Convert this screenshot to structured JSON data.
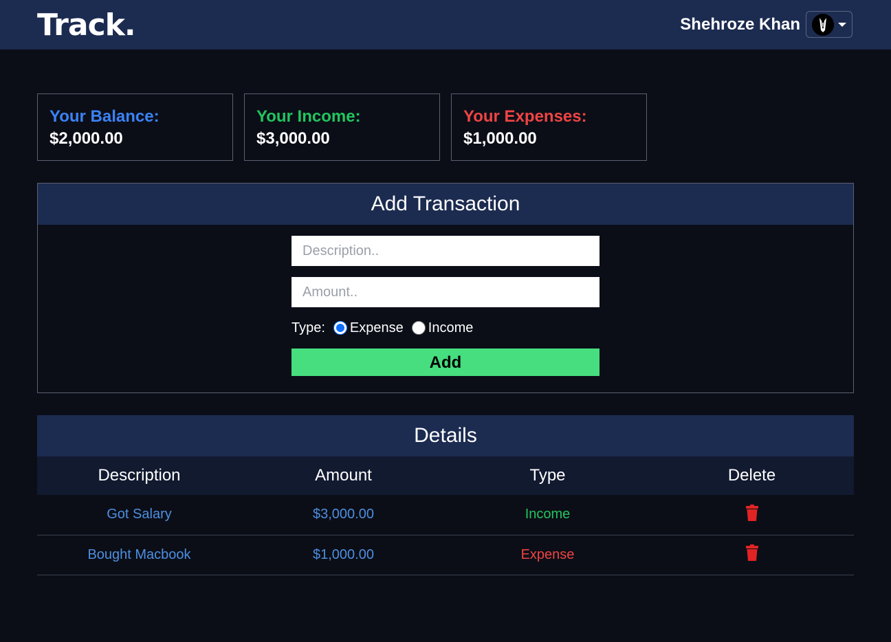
{
  "header": {
    "brand": "Track.",
    "user_name": "Shehroze Khan"
  },
  "summary": {
    "balance": {
      "label": "Your Balance:",
      "value": "$2,000.00"
    },
    "income": {
      "label": "Your Income:",
      "value": "$3,000.00"
    },
    "expenses": {
      "label": "Your Expenses:",
      "value": "$1,000.00"
    }
  },
  "add_form": {
    "title": "Add Transaction",
    "description_placeholder": "Description..",
    "amount_placeholder": "Amount..",
    "type_label": "Type:",
    "option_expense": "Expense",
    "option_income": "Income",
    "selected_type": "Expense",
    "add_label": "Add"
  },
  "details": {
    "title": "Details",
    "columns": [
      "Description",
      "Amount",
      "Type",
      "Delete"
    ],
    "rows": [
      {
        "description": "Got Salary",
        "amount": "$3,000.00",
        "type": "Income"
      },
      {
        "description": "Bought Macbook",
        "amount": "$1,000.00",
        "type": "Expense"
      }
    ]
  },
  "colors": {
    "navbar": "#1c2b50",
    "background": "#0b0e17",
    "balance": "#3b82f6",
    "income": "#22c55e",
    "expense": "#ef4444",
    "link": "#4d8fe0",
    "add_button": "#46de7f",
    "delete": "#e02424"
  },
  "icons": {
    "user_avatar": "user-avatar-icon",
    "dropdown": "caret-down-icon",
    "delete": "trash-icon"
  }
}
